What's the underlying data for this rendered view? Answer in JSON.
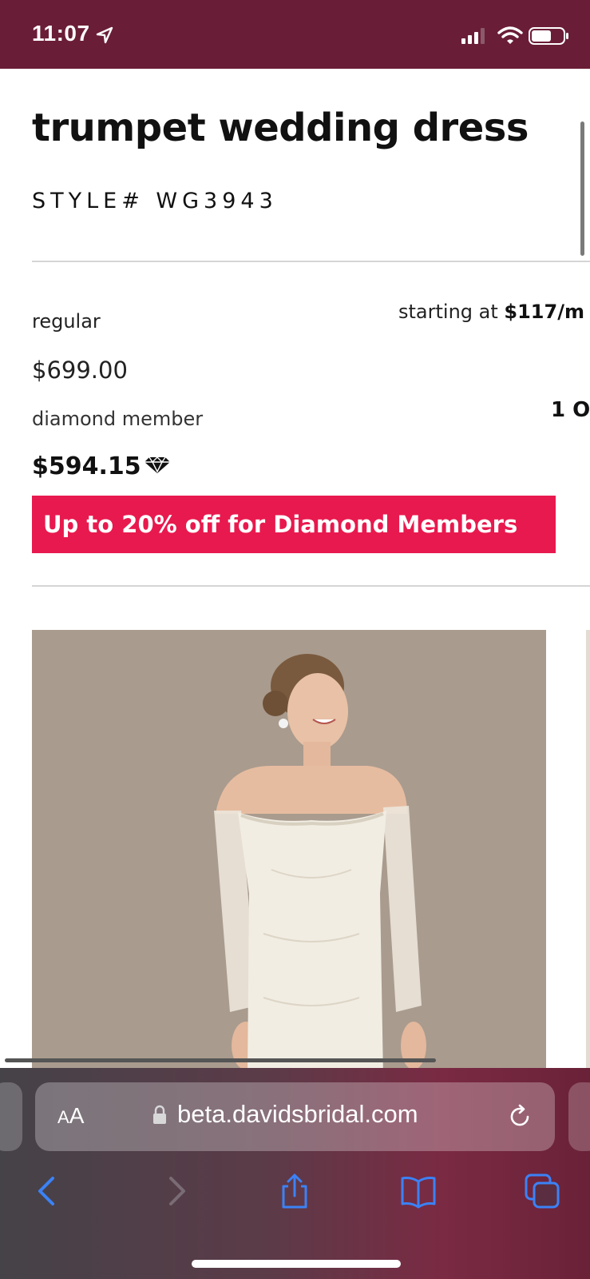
{
  "status_bar": {
    "time": "11:07"
  },
  "product": {
    "title": "trumpet wedding dress",
    "style_number": "STYLE# WG3943"
  },
  "pricing": {
    "regular_label": "regular",
    "regular_price": "$699.00",
    "diamond_label": "diamond member",
    "diamond_price": "$594.15",
    "installment_prefix": "starting at ",
    "installment_amount": "$117/m",
    "side_text": "1 O"
  },
  "promo": {
    "text": "Up to 20% off for Diamond Members"
  },
  "browser": {
    "text_size_label_small": "A",
    "text_size_label_big": "A",
    "url": "beta.davidsbridal.com"
  },
  "colors": {
    "status_bar": "#6a1d36",
    "promo_banner": "#e8194e",
    "image_background": "#a89a8d",
    "toolbar_icons": "#3b82f6"
  }
}
